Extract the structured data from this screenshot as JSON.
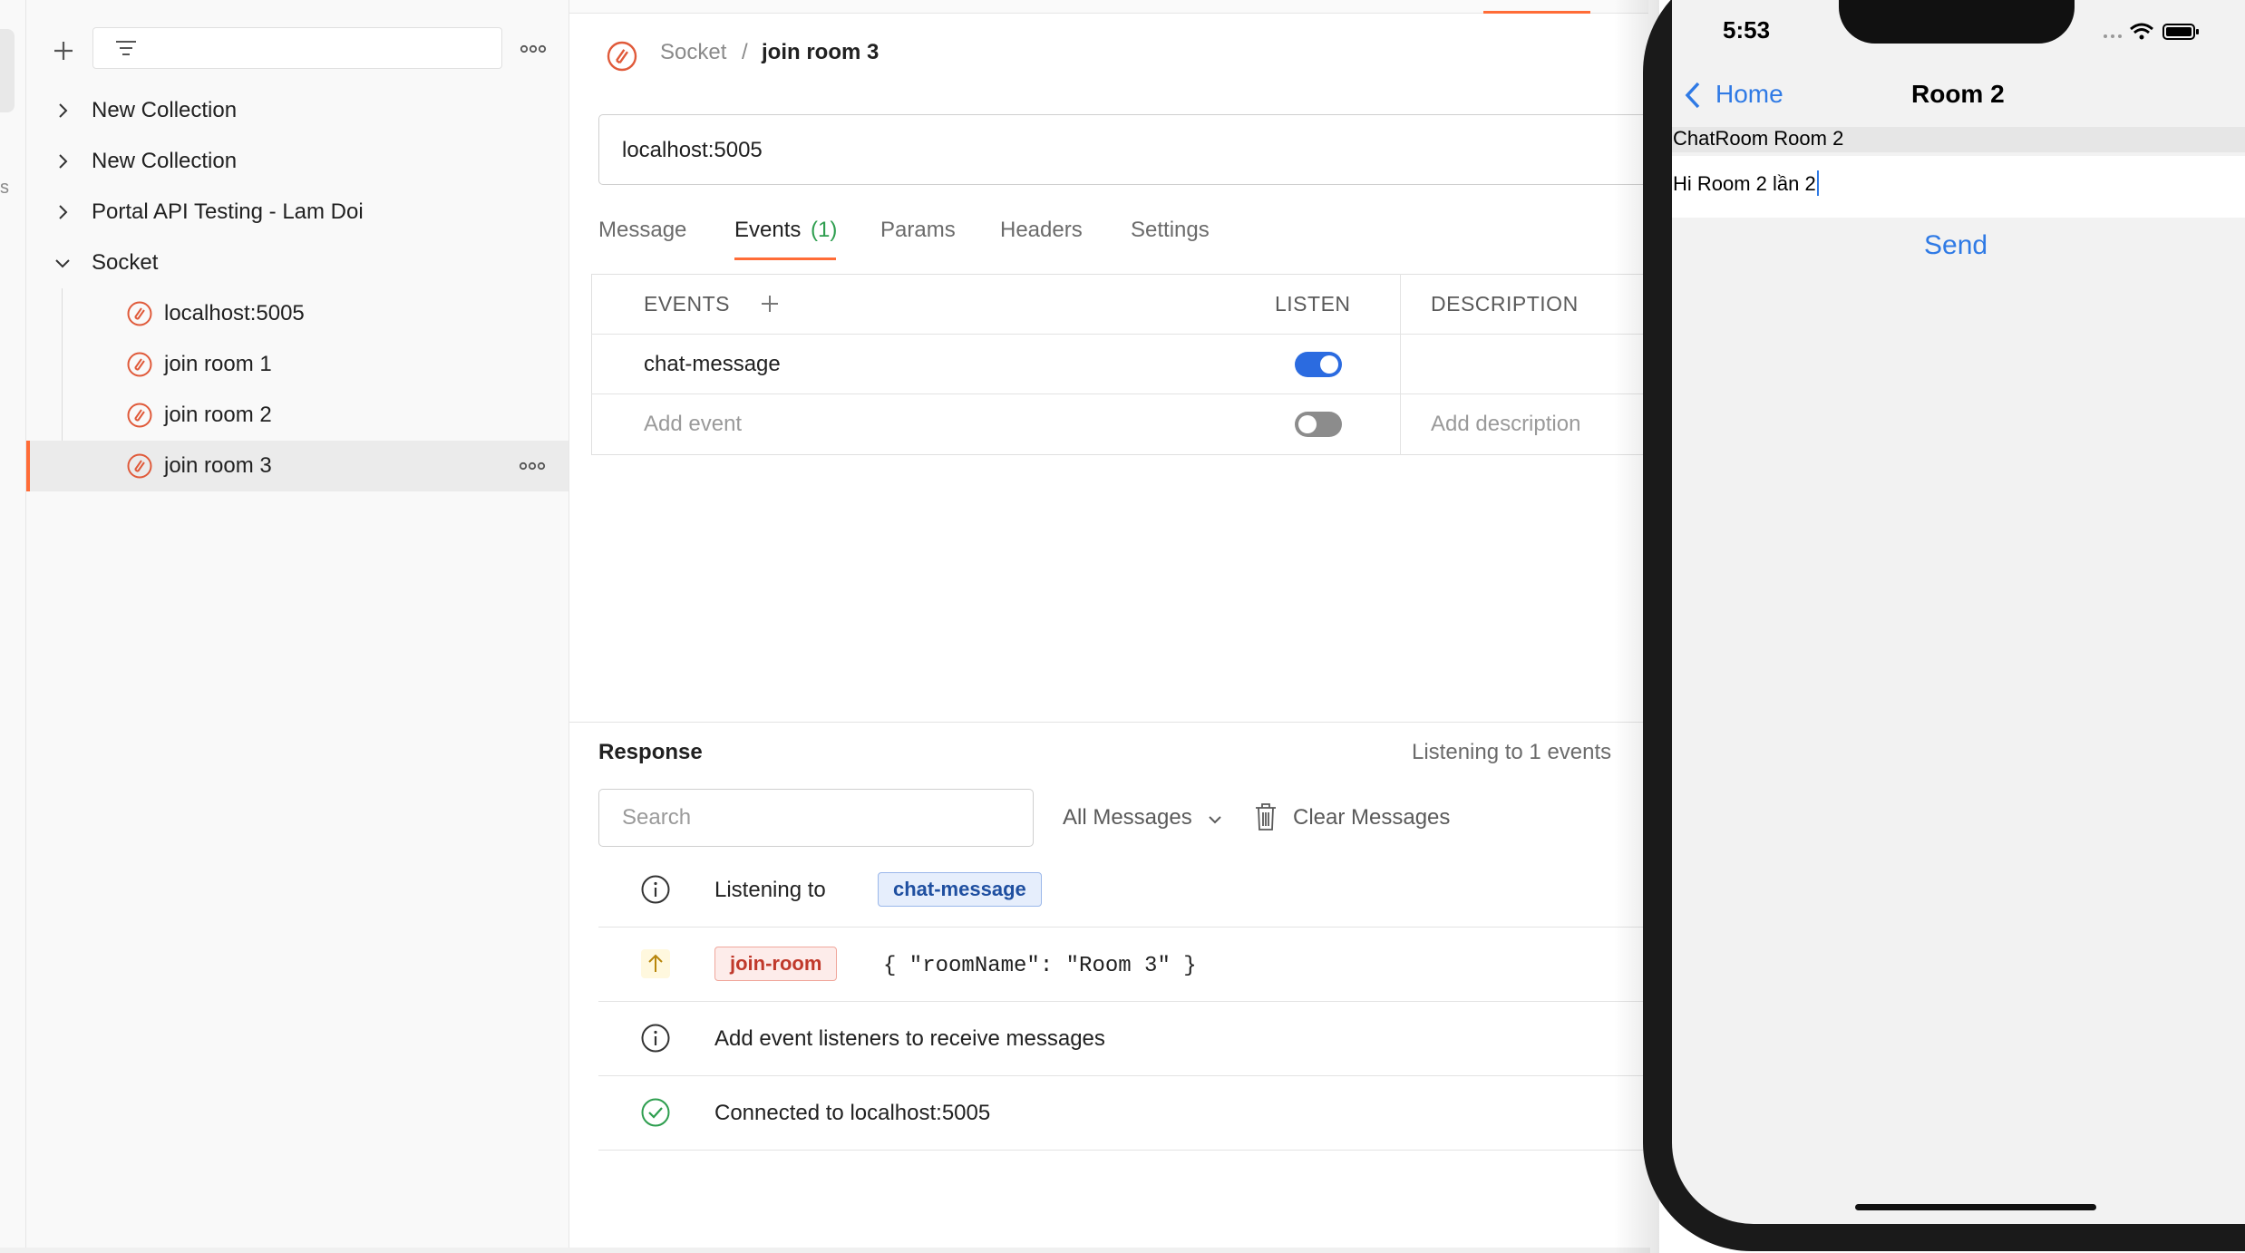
{
  "sidebar": {
    "items": [
      {
        "label": "New Collection",
        "expanded": false
      },
      {
        "label": "New Collection",
        "expanded": false
      },
      {
        "label": "Portal API Testing - Lam Doi",
        "expanded": false
      },
      {
        "label": "Socket",
        "expanded": true
      }
    ],
    "children": [
      {
        "label": "localhost:5005"
      },
      {
        "label": "join room 1"
      },
      {
        "label": "join room 2"
      },
      {
        "label": "join room 3",
        "active": true
      }
    ],
    "left_strip_letter": "s"
  },
  "breadcrumb": {
    "parent": "Socket",
    "separator": "/",
    "current": "join room 3"
  },
  "request": {
    "url": "localhost:5005"
  },
  "tabs": [
    {
      "label": "Message"
    },
    {
      "label": "Events",
      "count": "(1)",
      "active": true
    },
    {
      "label": "Params"
    },
    {
      "label": "Headers"
    },
    {
      "label": "Settings"
    }
  ],
  "events_table": {
    "headers": {
      "events": "EVENTS",
      "listen": "LISTEN",
      "description": "DESCRIPTION"
    },
    "rows": [
      {
        "event": "chat-message",
        "listen": true,
        "description": ""
      }
    ],
    "placeholder": {
      "event": "Add event",
      "description": "Add description",
      "listen": false
    }
  },
  "response": {
    "title": "Response",
    "status": "Listening to 1 events",
    "search_placeholder": "Search",
    "filter": "All Messages",
    "clear": "Clear Messages",
    "messages": [
      {
        "type": "info",
        "text": "Listening to",
        "tag": "chat-message"
      },
      {
        "type": "sent",
        "tag": "join-room",
        "payload": "{ \"roomName\": \"Room 3\" }"
      },
      {
        "type": "info",
        "text": "Add event listeners to receive messages"
      },
      {
        "type": "success",
        "text": "Connected to localhost:5005"
      }
    ]
  },
  "phone": {
    "time": "5:53",
    "back_label": "Home",
    "title": "Room 2",
    "room_label": "ChatRoom Room 2",
    "input_value": "Hi Room 2 lần 2",
    "send_label": "Send"
  },
  "colors": {
    "accent": "#ff6c37",
    "toggle_on": "#2b6be0",
    "ios_blue": "#2f7ae5",
    "success": "#2e9e4f"
  }
}
